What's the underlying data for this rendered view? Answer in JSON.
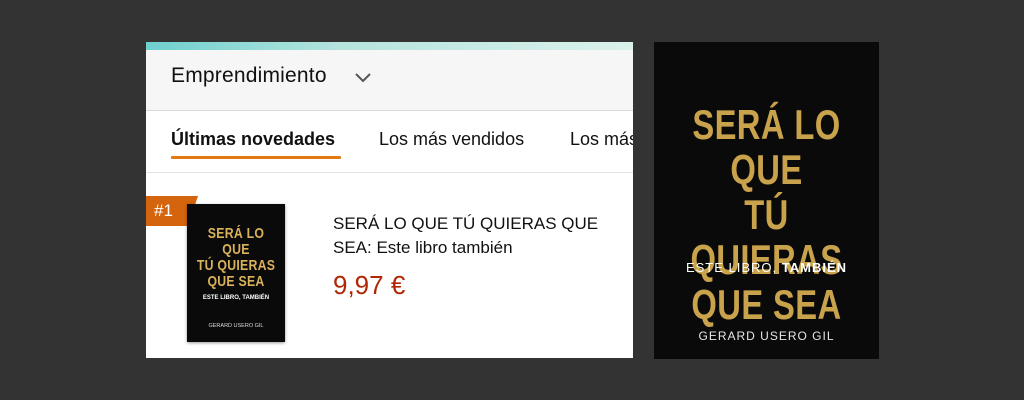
{
  "category": {
    "label": "Emprendimiento",
    "icon": "chevron-down-icon"
  },
  "tabs": [
    {
      "label": "Últimas novedades",
      "active": true
    },
    {
      "label": "Los más vendidos",
      "active": false
    },
    {
      "label": "Los más",
      "active": false
    }
  ],
  "product": {
    "rank": "#1",
    "title": "SERÁ LO QUE TÚ QUIERAS QUE SEA: Este libro también",
    "price": "9,97 €"
  },
  "book_cover": {
    "title_line1": "SERÁ LO QUE",
    "title_line2": "TÚ QUIERAS",
    "title_line3": "QUE SEA",
    "subtitle_part1": "ESTE LIBRO, ",
    "subtitle_part2": "TAMBIÉN",
    "author": "GERARD USERO GIL"
  },
  "colors": {
    "background": "#333333",
    "accent": "#e47911",
    "price": "#b12704",
    "cover_gold": "#c9a24c",
    "rank_flag": "#d4650e"
  }
}
